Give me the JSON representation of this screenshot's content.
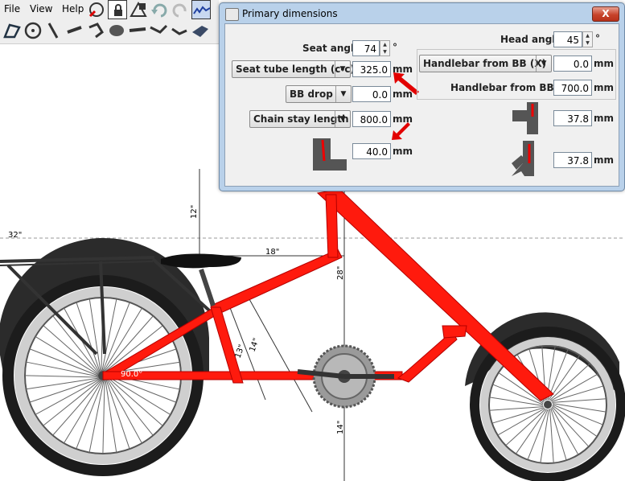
{
  "menu": {
    "file": "File",
    "view": "View",
    "help": "Help"
  },
  "toolbar_icons": [
    "wheel-settings-icon",
    "lock-icon",
    "frame-lock-icon",
    "undo-icon",
    "redo-icon",
    "graph-icon",
    "frame-icon",
    "wheel-icon",
    "fork-icon",
    "crank-icon",
    "chain-ring-icon",
    "cassette-icon",
    "pedal-icon",
    "handlebar-icon",
    "stem-icon",
    "saddle-icon"
  ],
  "dialog": {
    "title": "Primary dimensions",
    "close": "X",
    "seat_angle": {
      "label": "Seat angle",
      "value": "74",
      "unit": "°"
    },
    "seat_tube": {
      "label": "Seat tube length (c-c)",
      "value": "325.0",
      "unit": "mm"
    },
    "bb_drop": {
      "label": "BB drop",
      "value": "0.0",
      "unit": "mm"
    },
    "chain_stay": {
      "label": "Chain stay length",
      "value": "800.0",
      "unit": "mm"
    },
    "extra": {
      "value": "40.0",
      "unit": "mm"
    },
    "head_angle": {
      "label": "Head angle",
      "value": "45",
      "unit": "°"
    },
    "hb_x": {
      "label": "Handlebar from BB (X)",
      "value": "0.0",
      "unit": "mm"
    },
    "hb_y": {
      "label": "Handlebar from BB (Y)",
      "value": "700.0",
      "unit": "mm"
    },
    "tube_a": {
      "value": "37.8",
      "unit": "mm"
    },
    "tube_b": {
      "value": "37.8",
      "unit": "mm"
    }
  },
  "drawing": {
    "dim_32": "32\"",
    "dim_12": "12\"",
    "dim_18": "18\"",
    "dim_28": "28\"",
    "dim_13": "13\"",
    "dim_14a": "14\"",
    "dim_14b": "14\"",
    "angle": "90.0°",
    "colors": {
      "frame": "#ff1a0d",
      "frame_dark": "#b30000",
      "tire": "#2b2b2b",
      "arrow": "#e20000"
    }
  }
}
